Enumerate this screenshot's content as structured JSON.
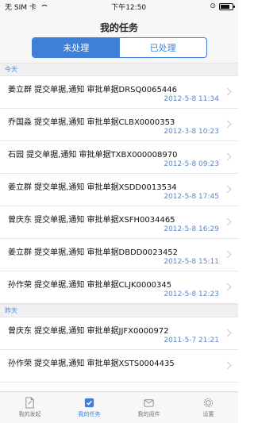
{
  "status_bar": {
    "carrier": "无 SIM 卡",
    "time": "下午12:50",
    "indicator": "⊙"
  },
  "nav": {
    "title": "我的任务",
    "segments": [
      "未处理",
      "已处理"
    ],
    "active_segment": 0
  },
  "sections": [
    {
      "label": "今天",
      "rows": [
        {
          "text": "姜立群 提交单据,通知 审批单据DRSQ0065446",
          "time": "2012-5-8 11:34"
        },
        {
          "text": "乔国淼 提交单据,通知 审批单据CLBX0000353",
          "time": "2012-3-8 10:23"
        },
        {
          "text": "石园 提交单据,通知 审批单据TXBX000008970",
          "time": "2012-5-8 09:23"
        },
        {
          "text": "姜立群 提交单据,通知 审批单据XSDD0013534",
          "time": "2012-5-8 17:45"
        },
        {
          "text": "曾庆东 提交单据,通知 审批单据XSFH0034465",
          "time": "2012-5-8 16:29"
        },
        {
          "text": "姜立群 提交单据,通知 审批单据DBDD0023452",
          "time": "2012-5-8 15:11"
        },
        {
          "text": "孙作荣 提交单据,通知 审批单据CLJK0000345",
          "time": "2012-5-8 12:23"
        }
      ]
    },
    {
      "label": "昨天",
      "rows": [
        {
          "text": "曾庆东 提交单据,通知 审批单据JJFX0000972",
          "time": "2011-5-7 21:21"
        },
        {
          "text": "孙作荣 提交单据,通知 审批单据XSTS0004435",
          "time": ""
        }
      ]
    }
  ],
  "tabs": [
    {
      "label": "我的发起",
      "icon": "document-icon"
    },
    {
      "label": "我的任务",
      "icon": "task-check-icon"
    },
    {
      "label": "我的阅件",
      "icon": "mail-icon"
    },
    {
      "label": "设置",
      "icon": "gear-icon"
    }
  ],
  "active_tab": 1,
  "colors": {
    "accent": "#3f7fd8",
    "time_text": "#5b86c6"
  }
}
